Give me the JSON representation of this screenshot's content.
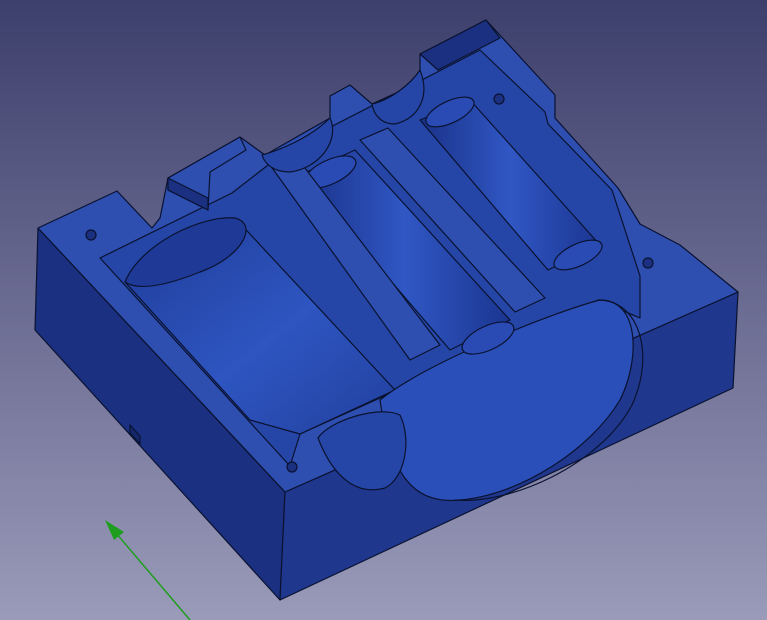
{
  "viewport": {
    "background_top": "#3d3f6c",
    "background_bottom": "#9a9ab9"
  },
  "model": {
    "object": "mold-half-with-cylindrical-cavities",
    "top_face_color": "#2e4fb0",
    "side_face_color": "#1b3080",
    "dark_face_color": "#14276b",
    "cavity_color": "#2546a6",
    "edge_color": "#0a1230"
  },
  "axis": {
    "color": "#1f9d1f",
    "icon": "axis-arrow-icon"
  }
}
